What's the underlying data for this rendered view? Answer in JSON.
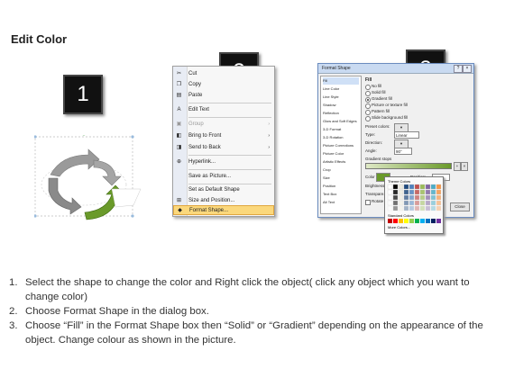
{
  "title": "Edit Color",
  "badges": [
    "1",
    "2",
    "3"
  ],
  "context_menu": {
    "items": [
      {
        "icon": "scissors-icon",
        "glyph": "✂",
        "label": "Cut",
        "arrow": "",
        "disabled": false,
        "highlight": false
      },
      {
        "icon": "copy-icon",
        "glyph": "❐",
        "label": "Copy",
        "arrow": "",
        "disabled": false,
        "highlight": false
      },
      {
        "icon": "paste-icon",
        "glyph": "▤",
        "label": "Paste",
        "arrow": "",
        "disabled": false,
        "highlight": false
      },
      {
        "icon": "edit-text-icon",
        "glyph": "A",
        "label": "Edit Text",
        "arrow": "",
        "disabled": false,
        "highlight": false
      },
      {
        "icon": "group-icon",
        "glyph": "▣",
        "label": "Group",
        "arrow": "›",
        "disabled": true,
        "highlight": false
      },
      {
        "icon": "bring-to-front-icon",
        "glyph": "◧",
        "label": "Bring to Front",
        "arrow": "›",
        "disabled": false,
        "highlight": false
      },
      {
        "icon": "send-to-back-icon",
        "glyph": "◨",
        "label": "Send to Back",
        "arrow": "›",
        "disabled": false,
        "highlight": false
      },
      {
        "icon": "hyperlink-icon",
        "glyph": "⊕",
        "label": "Hyperlink...",
        "arrow": "",
        "disabled": false,
        "highlight": false
      },
      {
        "icon": "",
        "glyph": "",
        "label": "Save as Picture...",
        "arrow": "",
        "disabled": false,
        "highlight": false
      },
      {
        "icon": "",
        "glyph": "",
        "label": "Set as Default Shape",
        "arrow": "",
        "disabled": false,
        "highlight": false
      },
      {
        "icon": "size-position-icon",
        "glyph": "⊞",
        "label": "Size and Position...",
        "arrow": "",
        "disabled": false,
        "highlight": false
      },
      {
        "icon": "format-shape-icon",
        "glyph": "◆",
        "label": "Format Shape...",
        "arrow": "",
        "disabled": false,
        "highlight": true
      }
    ]
  },
  "dialog": {
    "title": "Format Shape",
    "nav": [
      "Fill",
      "Line Color",
      "Line Style",
      "Shadow",
      "Reflection",
      "Glow and Soft Edges",
      "3-D Format",
      "3-D Rotation",
      "Picture Corrections",
      "Picture Color",
      "Artistic Effects",
      "Crop",
      "Size",
      "Position",
      "Text Box",
      "Alt Text"
    ],
    "section": "Fill",
    "options": [
      "No fill",
      "Solid fill",
      "Gradient fill",
      "Picture or texture fill",
      "Pattern fill",
      "Slide background fill"
    ],
    "selected_option": "Gradient fill",
    "fields": {
      "preset": "Preset colors:",
      "type": "Type:",
      "type_value": "Linear",
      "direction": "Direction:",
      "angle": "Angle:",
      "angle_value": "90°",
      "stops": "Gradient stops",
      "color": "Color",
      "position": "Position:",
      "position_value": "100%",
      "brightness": "Brightness",
      "transparency": "Transpare...",
      "rotate": "Rotate with shape"
    },
    "close": "Close",
    "palette": {
      "theme": "Theme Colors",
      "standard": "Standard Colors",
      "more": "More Colors..."
    }
  },
  "steps": [
    {
      "n": "1.",
      "text": "Select the shape to change the color and Right click the object( click any object which you want to change color)"
    },
    {
      "n": "2.",
      "text": "Choose Format Shape in the dialog box."
    },
    {
      "n": "3.",
      "text": "Choose “Fill” in the Format Shape box then “Solid” or “Gradient” depending on the appearance of the object. Change colour as shown in the picture."
    }
  ],
  "colors": {
    "accent_green": "#6a9a2a",
    "arrow_gray": "#8a8a8a",
    "highlight": "#fbd87c"
  }
}
